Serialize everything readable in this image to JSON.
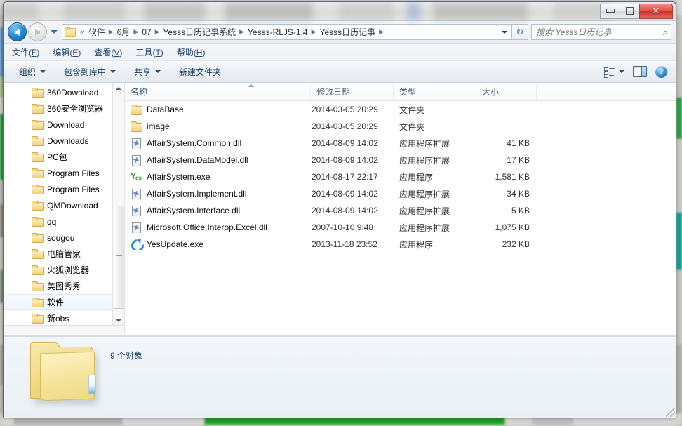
{
  "window": {
    "controls": {
      "minimize_label": "─",
      "maximize_label": "□",
      "close_label": "✕"
    }
  },
  "addressbar": {
    "back_tooltip": "后退",
    "forward_tooltip": "前进",
    "overflow_label": "«",
    "crumbs": [
      "软件",
      "6月",
      "07",
      "Yesss日历记事系统",
      "Yesss-RLJS-1.4",
      "Yesss日历记事"
    ],
    "separator": "▶",
    "refresh_label": "↻",
    "search": {
      "placeholder": "搜索 Yesss日历记事",
      "value": "",
      "icon": "search-icon",
      "icon_glyph": "⌕"
    }
  },
  "menubar": {
    "items": [
      {
        "text": "文件",
        "accel": "F"
      },
      {
        "text": "编辑",
        "accel": "E"
      },
      {
        "text": "查看",
        "accel": "V"
      },
      {
        "text": "工具",
        "accel": "T"
      },
      {
        "text": "帮助",
        "accel": "H"
      }
    ]
  },
  "commandbar": {
    "items": [
      {
        "label": "组织",
        "has_caret": true
      },
      {
        "label": "包含到库中",
        "has_caret": true
      },
      {
        "label": "共享",
        "has_caret": true
      },
      {
        "label": "新建文件夹",
        "has_caret": false
      }
    ],
    "right_icons": [
      {
        "name": "view-mode-icon",
        "caret": true
      },
      {
        "name": "preview-pane-icon",
        "caret": false
      },
      {
        "name": "help-icon",
        "glyph": "?"
      }
    ]
  },
  "navpane": {
    "items": [
      {
        "label": "360Download",
        "selected": false
      },
      {
        "label": "360安全浏览器",
        "selected": false
      },
      {
        "label": "Download",
        "selected": false
      },
      {
        "label": "Downloads",
        "selected": false
      },
      {
        "label": "PC包",
        "selected": false
      },
      {
        "label": "Program Files",
        "selected": false
      },
      {
        "label": "Program Files",
        "selected": false
      },
      {
        "label": "QMDownload",
        "selected": false
      },
      {
        "label": "qq",
        "selected": false
      },
      {
        "label": "sougou",
        "selected": false
      },
      {
        "label": "电脑管家",
        "selected": false
      },
      {
        "label": "火狐浏览器",
        "selected": false
      },
      {
        "label": "美图秀秀",
        "selected": false
      },
      {
        "label": "软件",
        "selected": true
      },
      {
        "label": "新obs",
        "selected": false
      }
    ]
  },
  "filelist": {
    "columns": [
      {
        "key": "name",
        "label": "名称",
        "sorted": "asc"
      },
      {
        "key": "date",
        "label": "修改日期",
        "sorted": null
      },
      {
        "key": "type",
        "label": "类型",
        "sorted": null
      },
      {
        "key": "size",
        "label": "大小",
        "sorted": null
      }
    ],
    "rows": [
      {
        "icon": "folder-icon",
        "name": "DataBase",
        "date": "2014-03-05 20:29",
        "type": "文件夹",
        "size": ""
      },
      {
        "icon": "folder-icon",
        "name": "image",
        "date": "2014-03-05 20:29",
        "type": "文件夹",
        "size": ""
      },
      {
        "icon": "dll-icon",
        "name": "AffairSystem.Common.dll",
        "date": "2014-08-09 14:02",
        "type": "应用程序扩展",
        "size": "41 KB"
      },
      {
        "icon": "dll-icon",
        "name": "AffairSystem.DataModel.dll",
        "date": "2014-08-09 14:02",
        "type": "应用程序扩展",
        "size": "17 KB"
      },
      {
        "icon": "yes-app-icon",
        "name": "AffairSystem.exe",
        "date": "2014-08-17 22:17",
        "type": "应用程序",
        "size": "1,581 KB"
      },
      {
        "icon": "dll-icon",
        "name": "AffairSystem.Implement.dll",
        "date": "2014-08-09 14:02",
        "type": "应用程序扩展",
        "size": "34 KB"
      },
      {
        "icon": "dll-icon",
        "name": "AffairSystem.Interface.dll",
        "date": "2014-08-09 14:02",
        "type": "应用程序扩展",
        "size": "5 KB"
      },
      {
        "icon": "dll-icon",
        "name": "Microsoft.Office.Interop.Excel.dll",
        "date": "2007-10-10 9:48",
        "type": "应用程序扩展",
        "size": "1,075 KB"
      },
      {
        "icon": "update-icon",
        "name": "YesUpdate.exe",
        "date": "2013-11-18 23:52",
        "type": "应用程序",
        "size": "232 KB"
      }
    ]
  },
  "detailspane": {
    "preview_icon": "large-folder-icon",
    "status_text": "9 个对象"
  },
  "colors": {
    "accent": "#2e74b5",
    "close_button": "#cc2e25",
    "folder_yellow": "#f2cf72",
    "link_text": "#26486f",
    "taskbar_progress_green": "#19a119"
  }
}
